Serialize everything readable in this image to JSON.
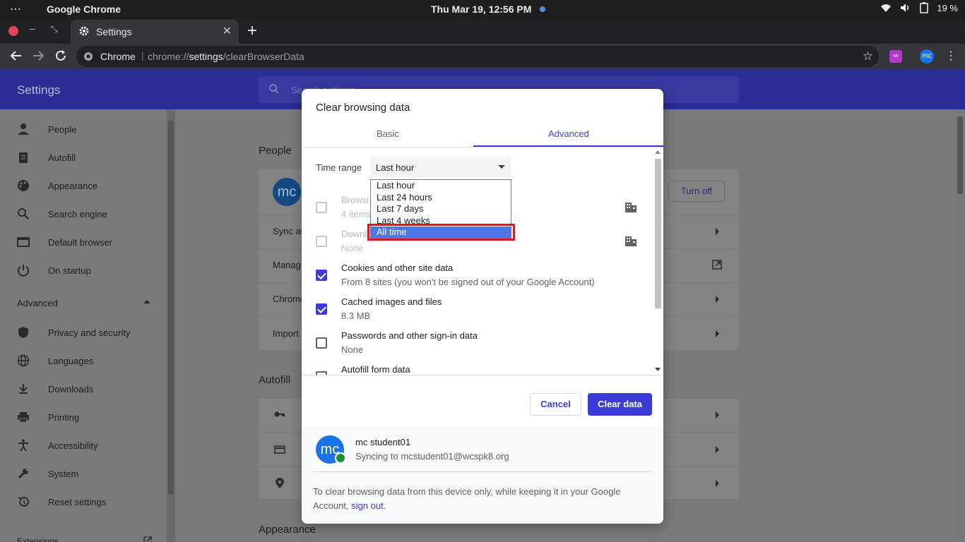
{
  "os": {
    "app_name": "Google Chrome",
    "clock": "Thu Mar 19, 12:56 PM",
    "battery": "19 %"
  },
  "browser": {
    "tab_title": "Settings",
    "omnibox_chip": "Chrome",
    "url_prefix": "chrome://",
    "url_host": "settings",
    "url_path": "/clearBrowserData",
    "ext_label": "rw",
    "avatar_initials": "mc"
  },
  "settings": {
    "header_title": "Settings",
    "search_placeholder": "Search settings",
    "nav": [
      {
        "label": "People",
        "icon": "person-icon"
      },
      {
        "label": "Autofill",
        "icon": "clipboard-icon"
      },
      {
        "label": "Appearance",
        "icon": "palette-icon"
      },
      {
        "label": "Search engine",
        "icon": "search-icon"
      },
      {
        "label": "Default browser",
        "icon": "browser-icon"
      },
      {
        "label": "On startup",
        "icon": "power-icon"
      }
    ],
    "advanced_label": "Advanced",
    "advanced_nav": [
      {
        "label": "Privacy and security",
        "icon": "shield-icon"
      },
      {
        "label": "Languages",
        "icon": "globe-icon"
      },
      {
        "label": "Downloads",
        "icon": "download-icon"
      },
      {
        "label": "Printing",
        "icon": "printer-icon"
      },
      {
        "label": "Accessibility",
        "icon": "accessibility-icon"
      },
      {
        "label": "System",
        "icon": "wrench-icon"
      },
      {
        "label": "Reset settings",
        "icon": "restore-icon"
      }
    ],
    "extensions_label": "Extensions",
    "people_section": "People",
    "people_initials": "mc",
    "turn_off_label": "Turn off",
    "people_rows": [
      "Sync ar",
      "Manag",
      "Chrome",
      "Import"
    ],
    "autofill_section": "Autofill",
    "appearance_section": "Appearance"
  },
  "dialog": {
    "title": "Clear browsing data",
    "tabs": {
      "basic": "Basic",
      "advanced": "Advanced"
    },
    "time_range_label": "Time range",
    "time_range_value": "Last hour",
    "time_range_options": [
      "Last hour",
      "Last 24 hours",
      "Last 7 days",
      "Last 4 weeks",
      "All time"
    ],
    "time_range_highlighted": "All time",
    "items": [
      {
        "title": "Browsi",
        "subtitle": "4 items",
        "checked": false,
        "disabled": true
      },
      {
        "title": "Downlo",
        "subtitle": "None",
        "checked": false,
        "disabled": true
      },
      {
        "title": "Cookies and other site data",
        "subtitle": "From 8 sites (you won't be signed out of your Google Account)",
        "checked": true,
        "disabled": false
      },
      {
        "title": "Cached images and files",
        "subtitle": "8.3 MB",
        "checked": true,
        "disabled": false
      },
      {
        "title": "Passwords and other sign-in data",
        "subtitle": "None",
        "checked": false,
        "disabled": false
      },
      {
        "title": "Autofill form data",
        "subtitle": "",
        "checked": false,
        "disabled": false
      }
    ],
    "cancel_label": "Cancel",
    "clear_label": "Clear data",
    "account": {
      "initials": "mc",
      "name": "mc student01",
      "sync_text": "Syncing to mcstudent01@wcspk8.org"
    },
    "footer_text": "To clear browsing data from this device only, while keeping it in your Google Account,",
    "footer_link": "sign out",
    "footer_end": "."
  },
  "colors": {
    "accent": "#3b3bd5",
    "highlight_outline": "#e0151e",
    "selected_option": "#5076e6"
  }
}
